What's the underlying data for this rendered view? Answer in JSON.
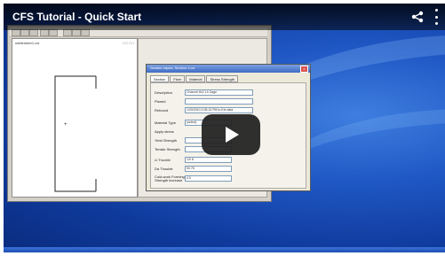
{
  "video": {
    "title": "CFS Tutorial - Quick Start",
    "share_icon": "share-icon",
    "menu_icon": "more-options-icon",
    "play_icon": "play-icon"
  },
  "app": {
    "drawing_label": "usMember1.cxr",
    "drawing_tools": "□ □ □ □"
  },
  "dialog": {
    "title": "Section Inputs: Section 1.cxr",
    "close": "x",
    "tabs": [
      "Section",
      "Fixer",
      "Material",
      "Stress Strength"
    ],
    "fields": [
      {
        "label": "Description",
        "value": "Channel 8x2 14 Gage"
      },
      {
        "label": "Planed",
        "value": ""
      },
      {
        "label": "Refound",
        "value": "1/20/2010 2:05:13 PM to Ext data"
      },
      {
        "label": "Material Type",
        "value": "(select)"
      },
      {
        "label": "Apply stress",
        "value": ""
      },
      {
        "label": "Yield Strength",
        "value": ""
      },
      {
        "label": "Tensile Strength",
        "value": ""
      },
      {
        "label": "Lt Trouble",
        "value": "1/0 8"
      },
      {
        "label": "Da Thouble",
        "value": "50.78"
      },
      {
        "label": "Cold-work Forming Strength increase",
        "value": "4.9"
      }
    ]
  },
  "colors": {
    "desktop": "#1f57c4",
    "dialog_title": "#3e6cc4",
    "player_bar": "#000000"
  }
}
